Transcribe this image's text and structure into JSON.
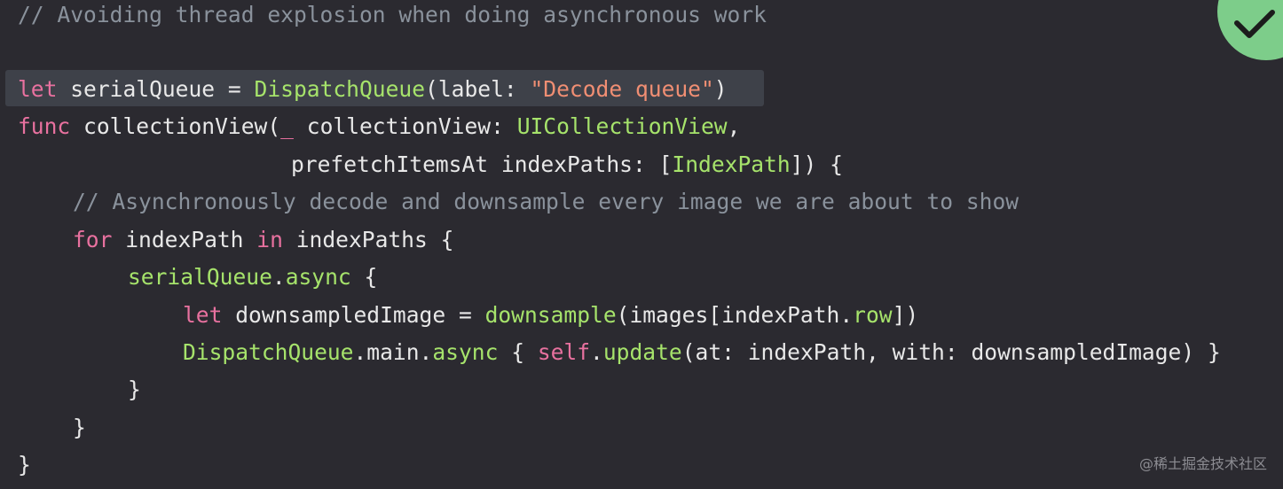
{
  "editor": {
    "lines": [
      {
        "name": "comment-line",
        "tokens": [
          {
            "t": "comment",
            "v": "// Avoiding thread explosion when doing asynchronous work"
          }
        ]
      },
      {
        "name": "serial-queue-line",
        "tokens": [
          {
            "t": "kw",
            "v": "let"
          },
          {
            "t": "plain",
            "v": " serialQueue = "
          },
          {
            "t": "type",
            "v": "DispatchQueue"
          },
          {
            "t": "plain",
            "v": "(label: "
          },
          {
            "t": "str",
            "v": "\"Decode queue\""
          },
          {
            "t": "plain",
            "v": ")"
          }
        ]
      },
      {
        "name": "func-decl-line",
        "tokens": [
          {
            "t": "kw",
            "v": "func"
          },
          {
            "t": "plain",
            "v": " collectionView("
          },
          {
            "t": "kw",
            "v": "_"
          },
          {
            "t": "plain",
            "v": " collectionView: "
          },
          {
            "t": "type",
            "v": "UICollectionView"
          },
          {
            "t": "plain",
            "v": ","
          }
        ]
      },
      {
        "name": "func-param-line",
        "tokens": [
          {
            "t": "plain",
            "v": "prefetchItemsAt indexPaths: ["
          },
          {
            "t": "type",
            "v": "IndexPath"
          },
          {
            "t": "plain",
            "v": "]) {"
          }
        ]
      },
      {
        "name": "comment-line-2",
        "tokens": [
          {
            "t": "comment",
            "v": "// Asynchronously decode and downsample every image we are about to show"
          }
        ]
      },
      {
        "name": "for-loop-line",
        "tokens": [
          {
            "t": "kw",
            "v": "for"
          },
          {
            "t": "plain",
            "v": " indexPath "
          },
          {
            "t": "kw",
            "v": "in"
          },
          {
            "t": "plain",
            "v": " indexPaths {"
          }
        ]
      },
      {
        "name": "async-line",
        "tokens": [
          {
            "t": "type",
            "v": "serialQueue"
          },
          {
            "t": "plain",
            "v": "."
          },
          {
            "t": "type",
            "v": "async"
          },
          {
            "t": "plain",
            "v": " {"
          }
        ]
      },
      {
        "name": "downsample-line",
        "tokens": [
          {
            "t": "kw",
            "v": "let"
          },
          {
            "t": "plain",
            "v": " downsampledImage = "
          },
          {
            "t": "type",
            "v": "downsample"
          },
          {
            "t": "plain",
            "v": "(images[indexPath."
          },
          {
            "t": "type",
            "v": "row"
          },
          {
            "t": "plain",
            "v": "])"
          }
        ]
      },
      {
        "name": "main-async-line",
        "tokens": [
          {
            "t": "type",
            "v": "DispatchQueue"
          },
          {
            "t": "plain",
            "v": ".main."
          },
          {
            "t": "type",
            "v": "async"
          },
          {
            "t": "plain",
            "v": " { "
          },
          {
            "t": "kw",
            "v": "self"
          },
          {
            "t": "plain",
            "v": "."
          },
          {
            "t": "type",
            "v": "update"
          },
          {
            "t": "plain",
            "v": "(at: indexPath, with: downsampledImage) }"
          }
        ]
      },
      {
        "name": "close-brace-line",
        "tokens": [
          {
            "t": "plain",
            "v": "}"
          }
        ]
      },
      {
        "name": "close-brace-line",
        "tokens": [
          {
            "t": "plain",
            "v": "}"
          }
        ]
      },
      {
        "name": "close-brace-line",
        "tokens": [
          {
            "t": "plain",
            "v": "}"
          }
        ]
      }
    ]
  },
  "badge": {
    "icon": "checkmark-icon",
    "color": "#7dcd8a"
  },
  "watermark": "@稀土掘金技术社区"
}
